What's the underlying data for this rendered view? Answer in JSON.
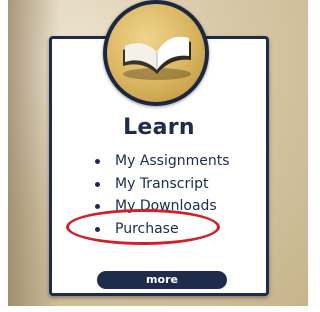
{
  "widget": {
    "title": "Learn",
    "icon": "open-book-icon",
    "menu": [
      {
        "label": "My Assignments"
      },
      {
        "label": "My Transcript"
      },
      {
        "label": "My Downloads"
      },
      {
        "label": "Purchase",
        "highlighted": true
      }
    ],
    "more_label": "more"
  },
  "colors": {
    "navy": "#1f2b4a",
    "gold": "#d8b45f",
    "highlight": "#d0202a"
  }
}
